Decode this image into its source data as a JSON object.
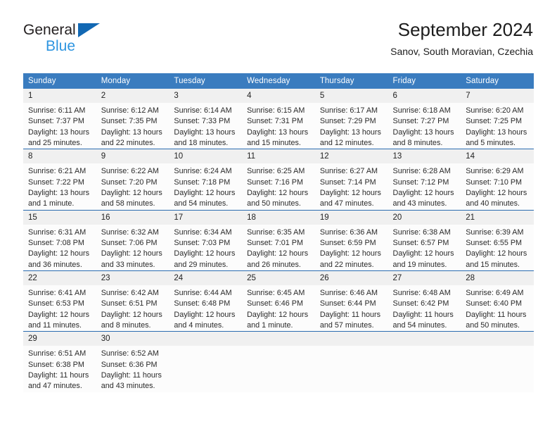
{
  "brand": {
    "line1": "General",
    "line2": "Blue",
    "logo_icon": "triangle-logo-icon"
  },
  "header": {
    "title": "September 2024",
    "subtitle": "Sanov, South Moravian, Czechia"
  },
  "colors": {
    "header_blue": "#3a7cbf",
    "row_separator_blue": "#2b6cb0",
    "daynum_band": "#f0f0f0",
    "cell_background": "#fcfcfc",
    "brand_dark": "#231f20",
    "brand_blue": "#2e95e0",
    "logo_blue": "#1268b3"
  },
  "weekday_headers": [
    "Sunday",
    "Monday",
    "Tuesday",
    "Wednesday",
    "Thursday",
    "Friday",
    "Saturday"
  ],
  "weeks": [
    [
      {
        "day": "1",
        "sunrise": "Sunrise: 6:11 AM",
        "sunset": "Sunset: 7:37 PM",
        "daylight_1": "Daylight: 13 hours",
        "daylight_2": "and 25 minutes."
      },
      {
        "day": "2",
        "sunrise": "Sunrise: 6:12 AM",
        "sunset": "Sunset: 7:35 PM",
        "daylight_1": "Daylight: 13 hours",
        "daylight_2": "and 22 minutes."
      },
      {
        "day": "3",
        "sunrise": "Sunrise: 6:14 AM",
        "sunset": "Sunset: 7:33 PM",
        "daylight_1": "Daylight: 13 hours",
        "daylight_2": "and 18 minutes."
      },
      {
        "day": "4",
        "sunrise": "Sunrise: 6:15 AM",
        "sunset": "Sunset: 7:31 PM",
        "daylight_1": "Daylight: 13 hours",
        "daylight_2": "and 15 minutes."
      },
      {
        "day": "5",
        "sunrise": "Sunrise: 6:17 AM",
        "sunset": "Sunset: 7:29 PM",
        "daylight_1": "Daylight: 13 hours",
        "daylight_2": "and 12 minutes."
      },
      {
        "day": "6",
        "sunrise": "Sunrise: 6:18 AM",
        "sunset": "Sunset: 7:27 PM",
        "daylight_1": "Daylight: 13 hours",
        "daylight_2": "and 8 minutes."
      },
      {
        "day": "7",
        "sunrise": "Sunrise: 6:20 AM",
        "sunset": "Sunset: 7:25 PM",
        "daylight_1": "Daylight: 13 hours",
        "daylight_2": "and 5 minutes."
      }
    ],
    [
      {
        "day": "8",
        "sunrise": "Sunrise: 6:21 AM",
        "sunset": "Sunset: 7:22 PM",
        "daylight_1": "Daylight: 13 hours",
        "daylight_2": "and 1 minute."
      },
      {
        "day": "9",
        "sunrise": "Sunrise: 6:22 AM",
        "sunset": "Sunset: 7:20 PM",
        "daylight_1": "Daylight: 12 hours",
        "daylight_2": "and 58 minutes."
      },
      {
        "day": "10",
        "sunrise": "Sunrise: 6:24 AM",
        "sunset": "Sunset: 7:18 PM",
        "daylight_1": "Daylight: 12 hours",
        "daylight_2": "and 54 minutes."
      },
      {
        "day": "11",
        "sunrise": "Sunrise: 6:25 AM",
        "sunset": "Sunset: 7:16 PM",
        "daylight_1": "Daylight: 12 hours",
        "daylight_2": "and 50 minutes."
      },
      {
        "day": "12",
        "sunrise": "Sunrise: 6:27 AM",
        "sunset": "Sunset: 7:14 PM",
        "daylight_1": "Daylight: 12 hours",
        "daylight_2": "and 47 minutes."
      },
      {
        "day": "13",
        "sunrise": "Sunrise: 6:28 AM",
        "sunset": "Sunset: 7:12 PM",
        "daylight_1": "Daylight: 12 hours",
        "daylight_2": "and 43 minutes."
      },
      {
        "day": "14",
        "sunrise": "Sunrise: 6:29 AM",
        "sunset": "Sunset: 7:10 PM",
        "daylight_1": "Daylight: 12 hours",
        "daylight_2": "and 40 minutes."
      }
    ],
    [
      {
        "day": "15",
        "sunrise": "Sunrise: 6:31 AM",
        "sunset": "Sunset: 7:08 PM",
        "daylight_1": "Daylight: 12 hours",
        "daylight_2": "and 36 minutes."
      },
      {
        "day": "16",
        "sunrise": "Sunrise: 6:32 AM",
        "sunset": "Sunset: 7:06 PM",
        "daylight_1": "Daylight: 12 hours",
        "daylight_2": "and 33 minutes."
      },
      {
        "day": "17",
        "sunrise": "Sunrise: 6:34 AM",
        "sunset": "Sunset: 7:03 PM",
        "daylight_1": "Daylight: 12 hours",
        "daylight_2": "and 29 minutes."
      },
      {
        "day": "18",
        "sunrise": "Sunrise: 6:35 AM",
        "sunset": "Sunset: 7:01 PM",
        "daylight_1": "Daylight: 12 hours",
        "daylight_2": "and 26 minutes."
      },
      {
        "day": "19",
        "sunrise": "Sunrise: 6:36 AM",
        "sunset": "Sunset: 6:59 PM",
        "daylight_1": "Daylight: 12 hours",
        "daylight_2": "and 22 minutes."
      },
      {
        "day": "20",
        "sunrise": "Sunrise: 6:38 AM",
        "sunset": "Sunset: 6:57 PM",
        "daylight_1": "Daylight: 12 hours",
        "daylight_2": "and 19 minutes."
      },
      {
        "day": "21",
        "sunrise": "Sunrise: 6:39 AM",
        "sunset": "Sunset: 6:55 PM",
        "daylight_1": "Daylight: 12 hours",
        "daylight_2": "and 15 minutes."
      }
    ],
    [
      {
        "day": "22",
        "sunrise": "Sunrise: 6:41 AM",
        "sunset": "Sunset: 6:53 PM",
        "daylight_1": "Daylight: 12 hours",
        "daylight_2": "and 11 minutes."
      },
      {
        "day": "23",
        "sunrise": "Sunrise: 6:42 AM",
        "sunset": "Sunset: 6:51 PM",
        "daylight_1": "Daylight: 12 hours",
        "daylight_2": "and 8 minutes."
      },
      {
        "day": "24",
        "sunrise": "Sunrise: 6:44 AM",
        "sunset": "Sunset: 6:48 PM",
        "daylight_1": "Daylight: 12 hours",
        "daylight_2": "and 4 minutes."
      },
      {
        "day": "25",
        "sunrise": "Sunrise: 6:45 AM",
        "sunset": "Sunset: 6:46 PM",
        "daylight_1": "Daylight: 12 hours",
        "daylight_2": "and 1 minute."
      },
      {
        "day": "26",
        "sunrise": "Sunrise: 6:46 AM",
        "sunset": "Sunset: 6:44 PM",
        "daylight_1": "Daylight: 11 hours",
        "daylight_2": "and 57 minutes."
      },
      {
        "day": "27",
        "sunrise": "Sunrise: 6:48 AM",
        "sunset": "Sunset: 6:42 PM",
        "daylight_1": "Daylight: 11 hours",
        "daylight_2": "and 54 minutes."
      },
      {
        "day": "28",
        "sunrise": "Sunrise: 6:49 AM",
        "sunset": "Sunset: 6:40 PM",
        "daylight_1": "Daylight: 11 hours",
        "daylight_2": "and 50 minutes."
      }
    ],
    [
      {
        "day": "29",
        "sunrise": "Sunrise: 6:51 AM",
        "sunset": "Sunset: 6:38 PM",
        "daylight_1": "Daylight: 11 hours",
        "daylight_2": "and 47 minutes."
      },
      {
        "day": "30",
        "sunrise": "Sunrise: 6:52 AM",
        "sunset": "Sunset: 6:36 PM",
        "daylight_1": "Daylight: 11 hours",
        "daylight_2": "and 43 minutes."
      },
      {
        "day": "",
        "sunrise": "",
        "sunset": "",
        "daylight_1": "",
        "daylight_2": ""
      },
      {
        "day": "",
        "sunrise": "",
        "sunset": "",
        "daylight_1": "",
        "daylight_2": ""
      },
      {
        "day": "",
        "sunrise": "",
        "sunset": "",
        "daylight_1": "",
        "daylight_2": ""
      },
      {
        "day": "",
        "sunrise": "",
        "sunset": "",
        "daylight_1": "",
        "daylight_2": ""
      },
      {
        "day": "",
        "sunrise": "",
        "sunset": "",
        "daylight_1": "",
        "daylight_2": ""
      }
    ]
  ]
}
